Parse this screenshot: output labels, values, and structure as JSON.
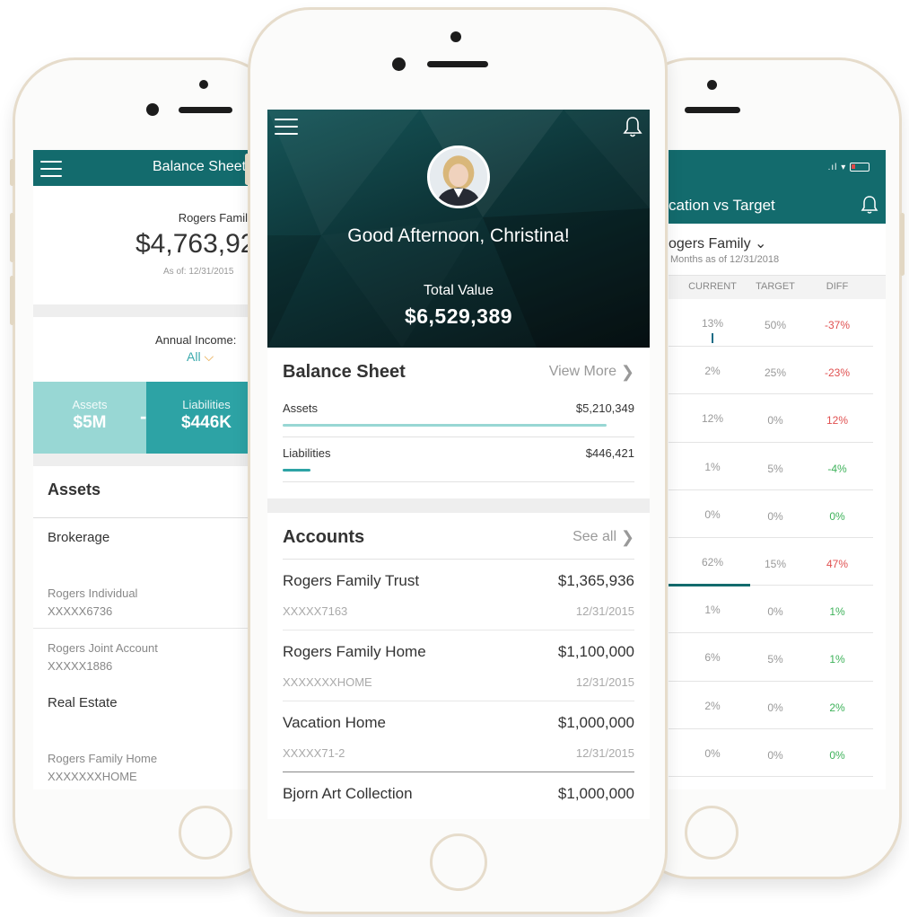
{
  "left_screen": {
    "header_title": "Balance Sheet",
    "family_selector": "Rogers Family ⌄",
    "total_value": "$4,763,92",
    "as_of": "As of: 12/31/2015",
    "annual_income_label": "Annual Income:",
    "annual_income_filter": "All",
    "assets_label": "Assets",
    "assets_value": "$5M",
    "minus_sign": "-",
    "liabilities_label": "Liabilities",
    "liabilities_value": "$446K",
    "section_title": "Assets",
    "groups": [
      {
        "category": "Brokerage",
        "accounts": [
          {
            "name": "Rogers Individual",
            "number": "XXXXX6736"
          },
          {
            "name": "Rogers Joint Account",
            "number": "XXXXX1886"
          }
        ]
      },
      {
        "category": "Real Estate",
        "accounts": [
          {
            "name": "Rogers Family Home",
            "number": "XXXXXXXHOME"
          }
        ]
      }
    ]
  },
  "center_screen": {
    "greeting": "Good Afternoon, Christina!",
    "total_value_label": "Total Value",
    "total_value": "$6,529,389",
    "balance_sheet": {
      "title": "Balance Sheet",
      "link": "View More",
      "rows": [
        {
          "label": "Assets",
          "value": "$5,210,349",
          "fill_fraction": 0.92
        },
        {
          "label": "Liabilities",
          "value": "$446,421",
          "fill_fraction": 0.08
        }
      ]
    },
    "accounts": {
      "title": "Accounts",
      "link": "See all",
      "items": [
        {
          "name": "Rogers Family Trust",
          "amount": "$1,365,936",
          "number": "XXXXX7163",
          "date": "12/31/2015"
        },
        {
          "name": "Rogers Family Home",
          "amount": "$1,100,000",
          "number": "XXXXXXXHOME",
          "date": "12/31/2015"
        },
        {
          "name": "Vacation Home",
          "amount": "$1,000,000",
          "number": "XXXXX71-2",
          "date": "12/31/2015"
        },
        {
          "name": "Bjorn Art Collection",
          "amount": "$1,000,000",
          "number": "",
          "date": ""
        }
      ]
    }
  },
  "right_screen": {
    "title": "cation vs Target",
    "family_selector": "ogers Family ⌄",
    "as_of": "Months as of 12/31/2018",
    "columns": [
      "CURRENT",
      "TARGET",
      "DIFF"
    ],
    "rows": [
      {
        "current": "13%",
        "target": "50%",
        "diff": "-37%",
        "sign": "neg"
      },
      {
        "current": "2%",
        "target": "25%",
        "diff": "-23%",
        "sign": "neg"
      },
      {
        "current": "12%",
        "target": "0%",
        "diff": "12%",
        "sign": "neg"
      },
      {
        "current": "1%",
        "target": "5%",
        "diff": "-4%",
        "sign": "pos"
      },
      {
        "current": "0%",
        "target": "0%",
        "diff": "0%",
        "sign": "pos"
      },
      {
        "current": "62%",
        "target": "15%",
        "diff": "47%",
        "sign": "neg"
      },
      {
        "current": "1%",
        "target": "0%",
        "diff": "1%",
        "sign": "pos"
      },
      {
        "current": "6%",
        "target": "5%",
        "diff": "1%",
        "sign": "pos"
      },
      {
        "current": "2%",
        "target": "0%",
        "diff": "2%",
        "sign": "pos"
      },
      {
        "current": "0%",
        "target": "0%",
        "diff": "0%",
        "sign": "pos"
      }
    ]
  },
  "colors": {
    "teal_dark": "#136b6d",
    "teal_mid": "#2da3a5",
    "teal_light": "#98d7d4",
    "negative": "#e05050",
    "positive": "#3eb25a",
    "accent_orange": "#e6a23c"
  },
  "icons": [
    "hamburger-menu-icon",
    "bell-icon",
    "chevron-right-icon",
    "chevron-down-icon",
    "wifi-icon",
    "battery-icon",
    "signal-icon"
  ]
}
